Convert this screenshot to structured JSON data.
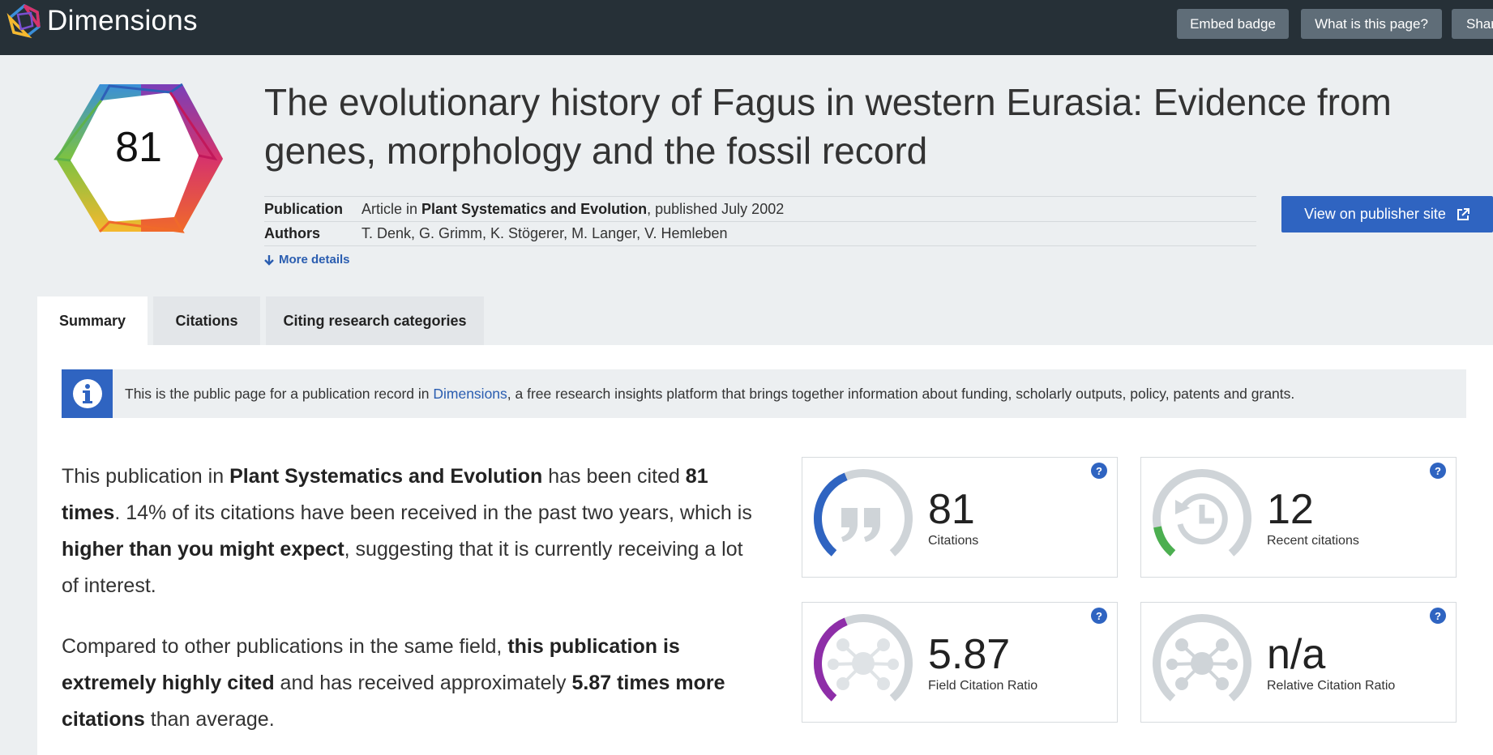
{
  "app": {
    "name": "Dimensions",
    "buttons": {
      "embed": "Embed badge",
      "what": "What is this page?",
      "share": "Share"
    }
  },
  "publication": {
    "score": "81",
    "title": "The evolutionary history of Fagus in western Eurasia: Evidence from genes, morphology and the fossil record",
    "meta": {
      "publication_key": "Publication",
      "publication_prefix": "Article in ",
      "journal": "Plant Systematics and Evolution",
      "published": ", published July 2002",
      "authors_key": "Authors",
      "authors": "T. Denk, G. Grimm, K. Stögerer, M. Langer, V. Hemleben"
    },
    "more_details": "More details",
    "publisher_button": "View on publisher site"
  },
  "tabs": [
    {
      "label": "Summary",
      "active": true
    },
    {
      "label": "Citations",
      "active": false
    },
    {
      "label": "Citing research categories",
      "active": false
    }
  ],
  "info": {
    "text_before": "This is the public page for a publication record in ",
    "link": "Dimensions",
    "text_after": ", a free research insights platform that brings together information about funding, scholarly outputs, policy, patents and grants."
  },
  "summary": {
    "p1": {
      "s1": "This publication in ",
      "b1": "Plant Systematics and Evolution",
      "s2": " has been cited ",
      "b2": "81 times",
      "s3": ". 14% of its citations have been received in the past two years, which is ",
      "b3": "higher than you might expect",
      "s4": ", suggesting that it is currently receiving a lot of interest."
    },
    "p2": {
      "s1": "Compared to other publications in the same field, ",
      "b1": "this publication is extremely highly cited",
      "s2": " and has received approximately ",
      "b2": "5.87 times more citations",
      "s3": " than average."
    }
  },
  "metrics": [
    {
      "value": "81",
      "label": "Citations",
      "color": "#2f64c1",
      "fill": 0.42,
      "icon": "quote-icon"
    },
    {
      "value": "12",
      "label": "Recent citations",
      "color": "#4caf50",
      "fill": 0.14,
      "icon": "clock-history-icon"
    },
    {
      "value": "5.87",
      "label": "Field Citation Ratio",
      "color": "#8e2ea8",
      "fill": 0.42,
      "icon": "network-icon"
    },
    {
      "value": "n/a",
      "label": "Relative Citation Ratio",
      "color": "#cfd4d8",
      "fill": 0,
      "icon": "network-icon"
    }
  ],
  "help_glyph": "?"
}
